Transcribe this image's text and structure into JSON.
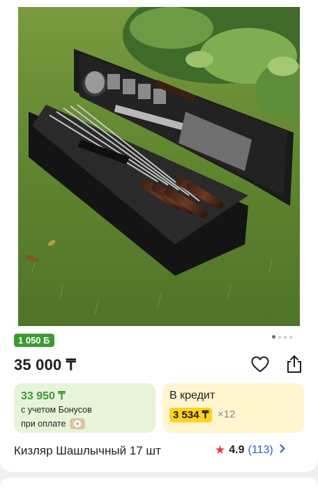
{
  "product": {
    "bonus_badge": "1 050 Б",
    "price": "35 000 ₸",
    "title": "Кизляр Шашлычный 17 шт",
    "image": {
      "alt": "Шашлычный набор в кейсе",
      "slide_count": 4,
      "active_slide": 1
    }
  },
  "icons": {
    "favorite": "heart-icon",
    "share": "share-icon",
    "rating": "star-icon",
    "more": "chevron-right-icon"
  },
  "bonus": {
    "price": "33 950 ₸",
    "line1": "с учетом Бонусов",
    "line2": "при оплате"
  },
  "credit": {
    "title": "В кредит",
    "monthly": "3 534 ₸",
    "months": "×12"
  },
  "rating": {
    "star": "★",
    "score": "4.9",
    "count": "(113)",
    "chevron": "›"
  },
  "colors": {
    "bonus_green": "#3d9a31",
    "credit_yellow": "#ffd21f",
    "link_blue": "#2b5fc7",
    "star_red": "#e53935"
  }
}
